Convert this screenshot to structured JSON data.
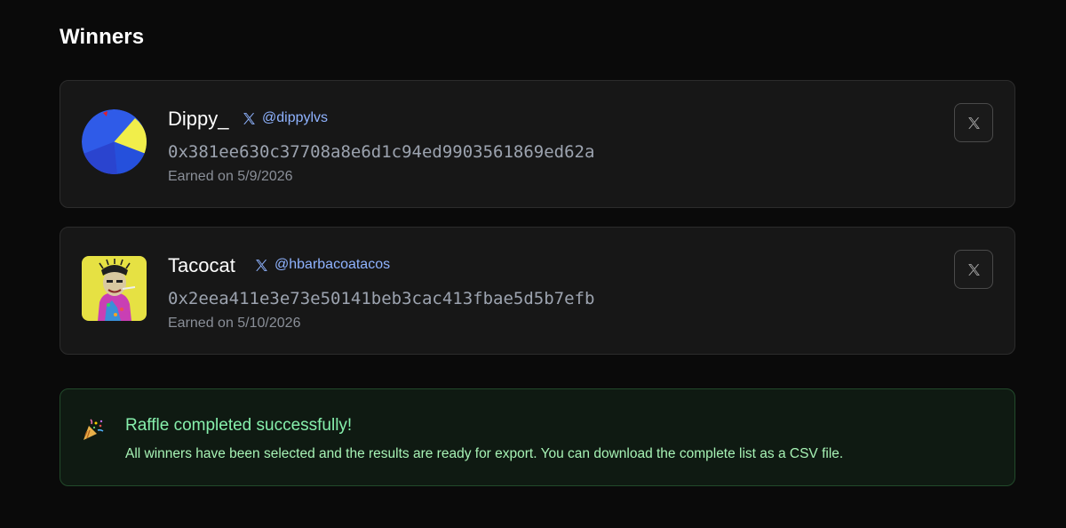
{
  "section": {
    "title": "Winners"
  },
  "winners": [
    {
      "name": "Dippy_",
      "handle": "@dippylvs",
      "wallet": "0x381ee630c37708a8e6d1c94ed9903561869ed62a",
      "earned": "Earned on 5/9/2026",
      "avatar_icon": "pie-avatar",
      "avatar_colors": [
        "#2f5be8",
        "#f1ee4a",
        "#e01f2b"
      ]
    },
    {
      "name": "Tacocat",
      "handle": "@hbarbacoatacos",
      "wallet": "0x2eea411e3e73e50141beb3cac413fbae5d5b7efb",
      "earned": "Earned on 5/10/2026",
      "avatar_icon": "nft-ape-avatar",
      "avatar_colors": [
        "#e6e143",
        "#c93fb4",
        "#3a8fd8"
      ]
    }
  ],
  "share_button_icon": "x-logo-icon",
  "banner": {
    "icon": "party-popper-icon",
    "title": "Raffle completed successfully!",
    "text": "All winners have been selected and the results are ready for export. You can download the complete list as a CSV file."
  },
  "colors": {
    "background": "#0a0a0a",
    "card": "#171717",
    "handle": "#8fb3ff",
    "success_title": "#86efac",
    "success_text": "#a7f3b5"
  }
}
